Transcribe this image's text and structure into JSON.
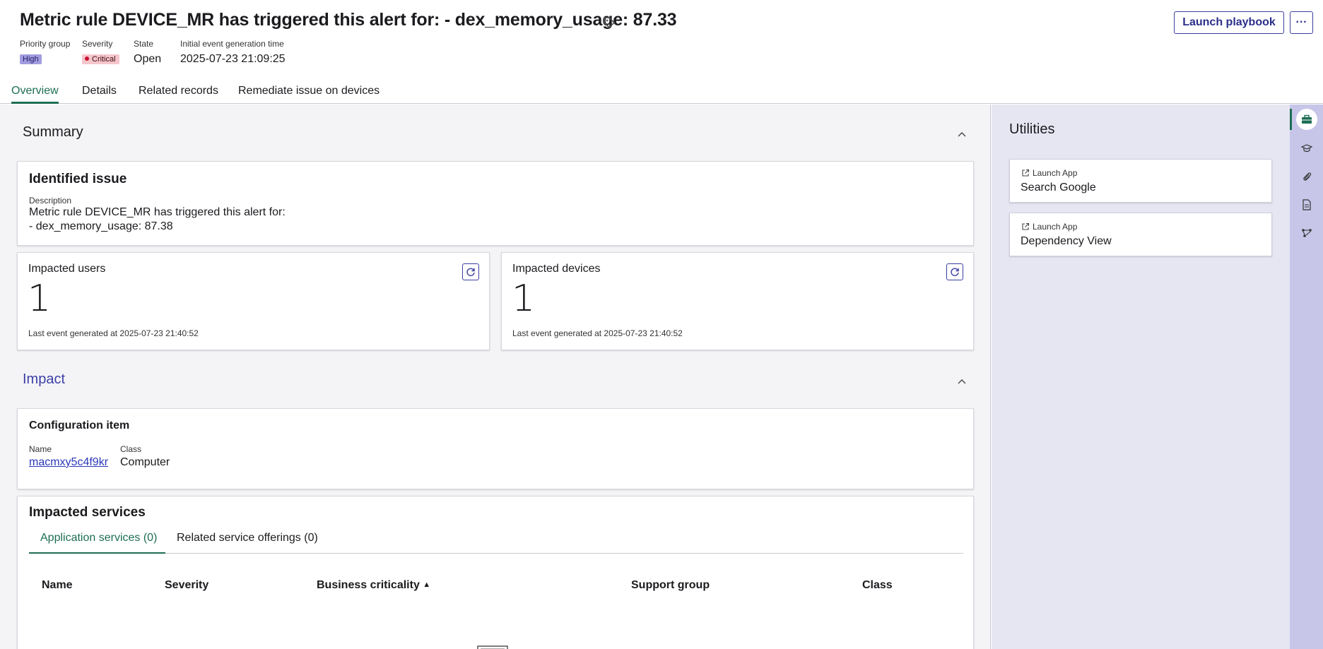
{
  "header": {
    "title": "Metric rule DEVICE_MR has triggered this alert for: - dex_memory_usage: 87.33",
    "launch_playbook": "Launch playbook",
    "more": "···",
    "priority_group": {
      "label": "Priority group",
      "value": "High"
    },
    "severity": {
      "label": "Severity",
      "value": "Critical"
    },
    "state": {
      "label": "State",
      "value": "Open"
    },
    "initial_time": {
      "label": "Initial event generation time",
      "value": "2025-07-23 21:09:25"
    }
  },
  "tabs": [
    "Overview",
    "Details",
    "Related records",
    "Remediate issue on devices"
  ],
  "summary": {
    "title": "Summary",
    "identified_issue": {
      "title": "Identified issue",
      "desc_label": "Description",
      "desc_line1": "Metric rule DEVICE_MR has triggered this alert for:",
      "desc_line2": "- dex_memory_usage: 87.38"
    },
    "impacted_users": {
      "title": "Impacted users",
      "count": "1",
      "footer": "Last event generated at 2025-07-23 21:40:52"
    },
    "impacted_devices": {
      "title": "Impacted devices",
      "count": "1",
      "footer": "Last event generated at 2025-07-23 21:40:52"
    }
  },
  "impact": {
    "title": "Impact",
    "config_item": {
      "title": "Configuration item",
      "name_label": "Name",
      "name_value": "macmxy5c4f9kr",
      "class_label": "Class",
      "class_value": "Computer"
    },
    "impacted_services": {
      "title": "Impacted services",
      "tabs": [
        "Application services (0)",
        "Related service offerings (0)"
      ],
      "columns": [
        "Name",
        "Severity",
        "Business criticality",
        "Support group",
        "Class"
      ]
    }
  },
  "utilities": {
    "title": "Utilities",
    "items": [
      {
        "sub": "Launch App",
        "title": "Search Google"
      },
      {
        "sub": "Launch App",
        "title": "Dependency View"
      }
    ]
  },
  "rail_icons": [
    "toolbox-icon",
    "graduation-cap-icon",
    "paperclip-icon",
    "document-icon",
    "workflow-icon"
  ],
  "colors": {
    "accent": "#1d6e55",
    "primary": "#2b2f8a",
    "high": "#a29ddf",
    "critical": "#c8102e"
  }
}
